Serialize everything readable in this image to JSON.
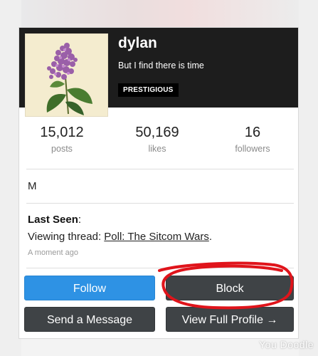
{
  "profile": {
    "username": "dylan",
    "status": "But I find there is time",
    "badge": "PRESTIGIOUS",
    "avatar_icon": "lilac-flower-illustration"
  },
  "stats": [
    {
      "value": "15,012",
      "label": "posts"
    },
    {
      "value": "50,169",
      "label": "likes"
    },
    {
      "value": "16",
      "label": "followers"
    }
  ],
  "about": {
    "text": "M"
  },
  "last_seen": {
    "title": "Last Seen",
    "prefix": "Viewing thread: ",
    "thread": "Poll: The Sitcom Wars",
    "suffix": ".",
    "time": "A moment ago"
  },
  "actions": {
    "follow": "Follow",
    "block": "Block",
    "message": "Send a Message",
    "profile": "View Full Profile →"
  },
  "annotation": {
    "color": "#e0141b",
    "target": "Block"
  },
  "watermark": "You Doodle",
  "colors": {
    "header_bg": "#1d1d1d",
    "follow_btn": "#2e92e4",
    "dark_btn": "#3f4346"
  }
}
